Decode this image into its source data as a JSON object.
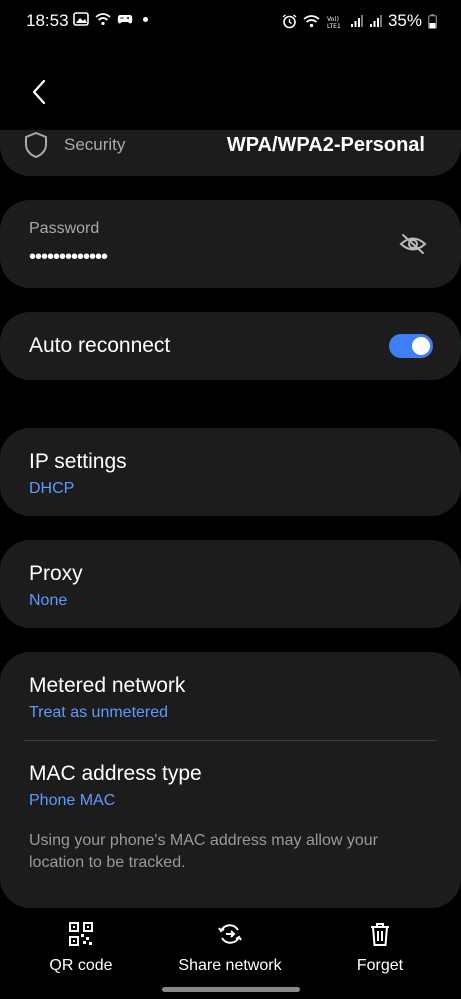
{
  "status_bar": {
    "time": "18:53",
    "battery": "35%"
  },
  "security": {
    "label": "Security",
    "value": "WPA/WPA2-Personal"
  },
  "password": {
    "label": "Password",
    "value": "•••••••••••••"
  },
  "auto_reconnect": {
    "label": "Auto reconnect",
    "enabled": true
  },
  "ip_settings": {
    "label": "IP settings",
    "value": "DHCP"
  },
  "proxy": {
    "label": "Proxy",
    "value": "None"
  },
  "metered": {
    "label": "Metered network",
    "value": "Treat as unmetered"
  },
  "mac": {
    "label": "MAC address type",
    "value": "Phone MAC",
    "note": "Using your phone's MAC address may allow your location to be tracked."
  },
  "bottom_bar": {
    "qr_label": "QR code",
    "share_label": "Share network",
    "forget_label": "Forget"
  },
  "colors": {
    "accent": "#3e7ff7",
    "link": "#5d9bff",
    "card": "#1c1c1c"
  }
}
